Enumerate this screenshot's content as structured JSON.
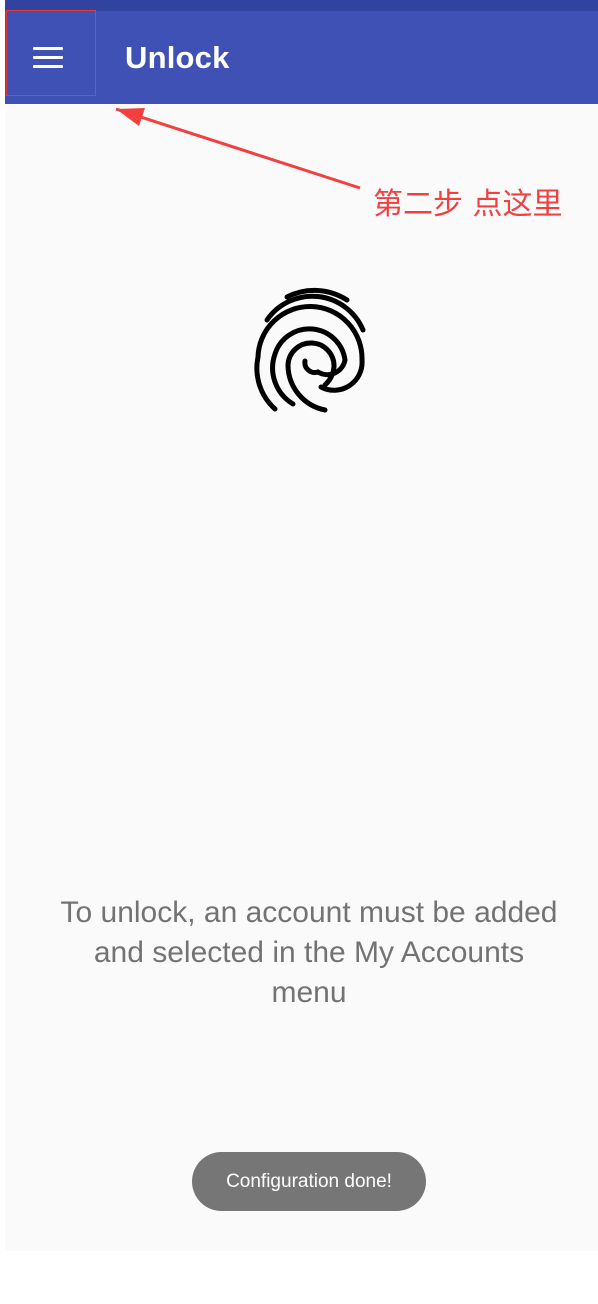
{
  "app_bar": {
    "title": "Unlock",
    "menu_icon": "hamburger-menu-icon",
    "color": "#3f51b5",
    "status_bar_color": "#3142a0"
  },
  "annotation": {
    "text": "第二步 点这里",
    "color": "#f24040"
  },
  "main": {
    "fingerprint_icon": "fingerprint-icon",
    "message": "To unlock, an account must be added and selected in the My Accounts menu"
  },
  "toast": {
    "text": "Configuration done!"
  }
}
